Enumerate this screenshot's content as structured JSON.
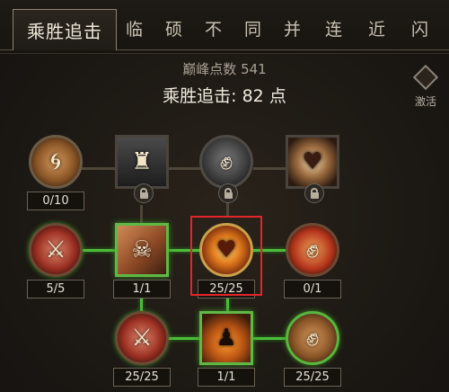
{
  "tabs": {
    "active": "乘胜追击",
    "others": [
      "临",
      "硕",
      "不",
      "同",
      "并",
      "连",
      "近",
      "闪"
    ]
  },
  "header": {
    "peak_label": "巅峰点数 541",
    "victory_label": "乘胜追击: 82 点"
  },
  "activate_label": "激活",
  "nodes": {
    "r1_n1": "0/10",
    "r2_n1": "5/5",
    "r2_n2": "1/1",
    "r2_n3": "25/25",
    "r2_n4": "0/1",
    "r3_n1": "25/25",
    "r3_n2": "1/1",
    "r3_n3": "25/25"
  },
  "icons": {
    "r1_n1": "swirl-icon",
    "r1_n2": "helmet-icon",
    "r1_n3": "fist-scroll-icon",
    "r1_n4": "heart-icon",
    "r2_n1": "crossed-blades-icon",
    "r2_n2": "knife-hand-icon",
    "r2_n3": "flame-heart-icon",
    "r2_n4": "fist-strike-icon",
    "r3_n1": "crossed-blades-icon",
    "r3_n2": "silhouette-icon",
    "r3_n3": "fist-icon"
  },
  "colors": {
    "active_path": "#4cbd3a",
    "highlight": "#e3262a"
  }
}
